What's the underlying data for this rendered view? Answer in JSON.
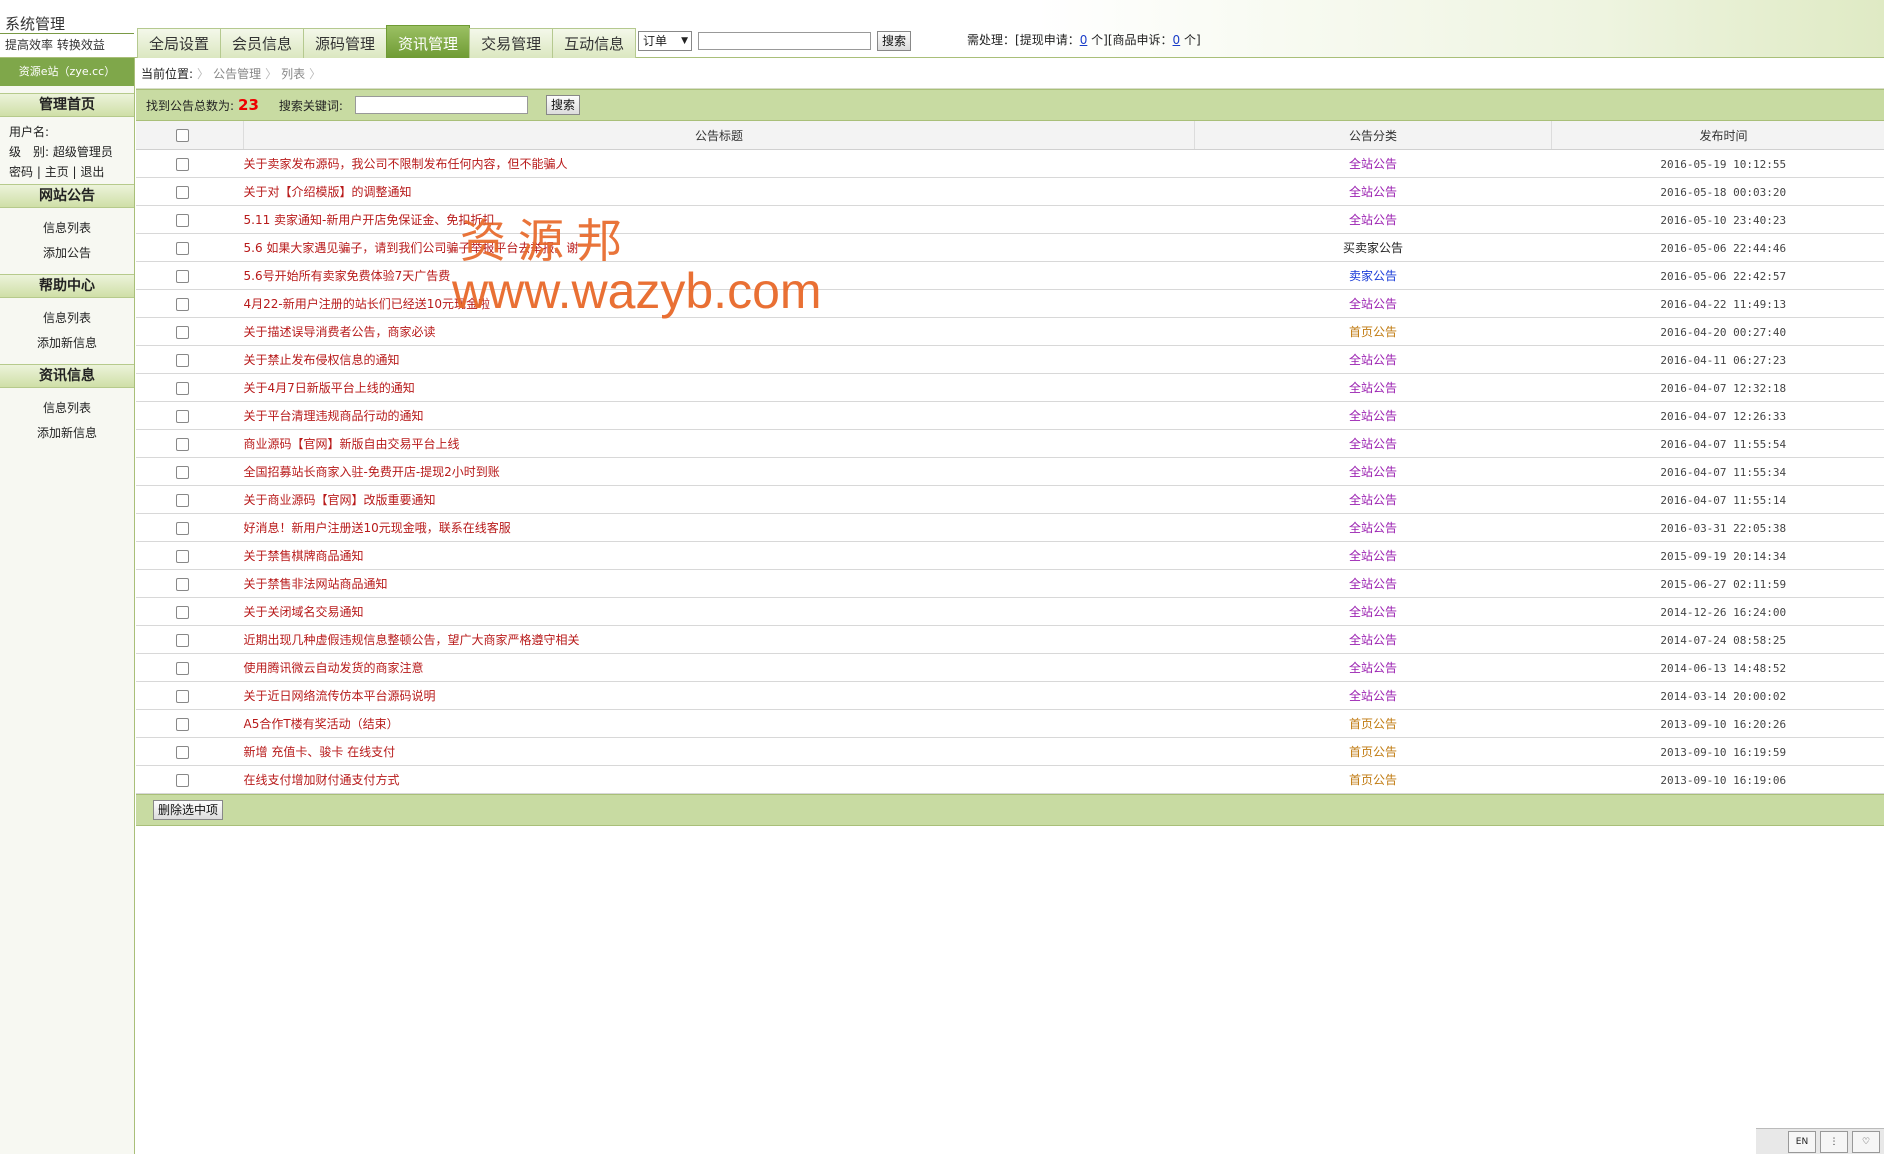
{
  "header": {
    "system_title": "系统管理",
    "slogan": "提高效率 转换效益",
    "tabs": [
      "全局设置",
      "会员信息",
      "源码管理",
      "资讯管理",
      "交易管理",
      "互动信息"
    ],
    "active_tab_index": 3,
    "search_select_value": "订单",
    "search_button": "搜索",
    "pending": {
      "label": "需处理：",
      "withdraw_label": "[提现申请：",
      "withdraw_count": "0",
      "withdraw_unit": "个]",
      "complaint_label": "[商品申诉：",
      "complaint_count": "0",
      "complaint_unit": "个]"
    }
  },
  "sidebar": {
    "site_badge": "资源e站（zye.cc）",
    "sections": {
      "home": {
        "title": "管理首页"
      },
      "notice": {
        "title": "网站公告",
        "items": [
          "信息列表",
          "添加公告"
        ]
      },
      "help": {
        "title": "帮助中心",
        "items": [
          "信息列表",
          "添加新信息"
        ]
      },
      "news": {
        "title": "资讯信息",
        "items": [
          "信息列表",
          "添加新信息"
        ]
      }
    },
    "user": {
      "username_label": "用户名:",
      "level_label": "级　别:",
      "level_value": "超级管理员",
      "password_link": "密码",
      "home_link": "主页",
      "logout_link": "退出"
    }
  },
  "breadcrumb": {
    "label": "当前位置:",
    "items": [
      "公告管理",
      "列表"
    ]
  },
  "search": {
    "total_label": "找到公告总数为:",
    "total": "23",
    "keyword_label": "搜索关键词:",
    "button": "搜索"
  },
  "table": {
    "headers": [
      "公告标题",
      "公告分类",
      "发布时间"
    ],
    "rows": [
      {
        "title": "关于卖家发布源码，我公司不限制发布任何内容，但不能骗人",
        "category": "全站公告",
        "date": "2016-05-19 10:12:55"
      },
      {
        "title": "关于对【介绍模版】的调整通知",
        "category": "全站公告",
        "date": "2016-05-18 00:03:20"
      },
      {
        "title": "5.11 卖家通知-新用户开店免保证金、免扣折扣",
        "category": "全站公告",
        "date": "2016-05-10 23:40:23"
      },
      {
        "title": "5.6 如果大家遇见骗子，请到我们公司骗子举报平台去举报。谢",
        "category": "买卖家公告",
        "date": "2016-05-06 22:44:46"
      },
      {
        "title": "5.6号开始所有卖家免费体验7天广告费",
        "category": "卖家公告",
        "date": "2016-05-06 22:42:57"
      },
      {
        "title": "4月22-新用户注册的站长们已经送10元现金啦",
        "category": "全站公告",
        "date": "2016-04-22 11:49:13"
      },
      {
        "title": "关于描述误导消费者公告，商家必读",
        "category": "首页公告",
        "date": "2016-04-20 00:27:40"
      },
      {
        "title": "关于禁止发布侵权信息的通知",
        "category": "全站公告",
        "date": "2016-04-11 06:27:23"
      },
      {
        "title": "关于4月7日新版平台上线的通知",
        "category": "全站公告",
        "date": "2016-04-07 12:32:18"
      },
      {
        "title": "关于平台清理违规商品行动的通知",
        "category": "全站公告",
        "date": "2016-04-07 12:26:33"
      },
      {
        "title": "商业源码【官网】新版自由交易平台上线",
        "category": "全站公告",
        "date": "2016-04-07 11:55:54"
      },
      {
        "title": "全国招募站长商家入驻-免费开店-提现2小时到账",
        "category": "全站公告",
        "date": "2016-04-07 11:55:34"
      },
      {
        "title": "关于商业源码【官网】改版重要通知",
        "category": "全站公告",
        "date": "2016-04-07 11:55:14"
      },
      {
        "title": "好消息！新用户注册送10元现金哦，联系在线客服",
        "category": "全站公告",
        "date": "2016-03-31 22:05:38"
      },
      {
        "title": "关于禁售棋牌商品通知",
        "category": "全站公告",
        "date": "2015-09-19 20:14:34"
      },
      {
        "title": "关于禁售非法网站商品通知",
        "category": "全站公告",
        "date": "2015-06-27 02:11:59"
      },
      {
        "title": "关于关闭域名交易通知",
        "category": "全站公告",
        "date": "2014-12-26 16:24:00"
      },
      {
        "title": "近期出现几种虚假违规信息整顿公告，望广大商家严格遵守相关",
        "category": "全站公告",
        "date": "2014-07-24 08:58:25"
      },
      {
        "title": "使用腾讯微云自动发货的商家注意",
        "category": "全站公告",
        "date": "2014-06-13 14:48:52"
      },
      {
        "title": "关于近日网络流传仿本平台源码说明",
        "category": "全站公告",
        "date": "2014-03-14 20:00:02"
      },
      {
        "title": "A5合作T楼有奖活动（结束）",
        "category": "首页公告",
        "date": "2013-09-10 16:20:26"
      },
      {
        "title": "新增 充值卡、骏卡 在线支付",
        "category": "首页公告",
        "date": "2013-09-10 16:19:59"
      },
      {
        "title": "在线支付增加财付通支付方式",
        "category": "首页公告",
        "date": "2013-09-10 16:19:06"
      }
    ]
  },
  "category_colors": {
    "全站公告": "#9a1fb0",
    "买卖家公告": "#222222",
    "卖家公告": "#1a3cd8",
    "首页公告": "#c07a10"
  },
  "actions": {
    "delete_selected": "删除选中项"
  },
  "watermark": {
    "line1": "资源邦",
    "line2": "www.wazyb.com"
  },
  "tray": {
    "lang": "EN",
    "dots": "⋮",
    "heart": "♡"
  }
}
